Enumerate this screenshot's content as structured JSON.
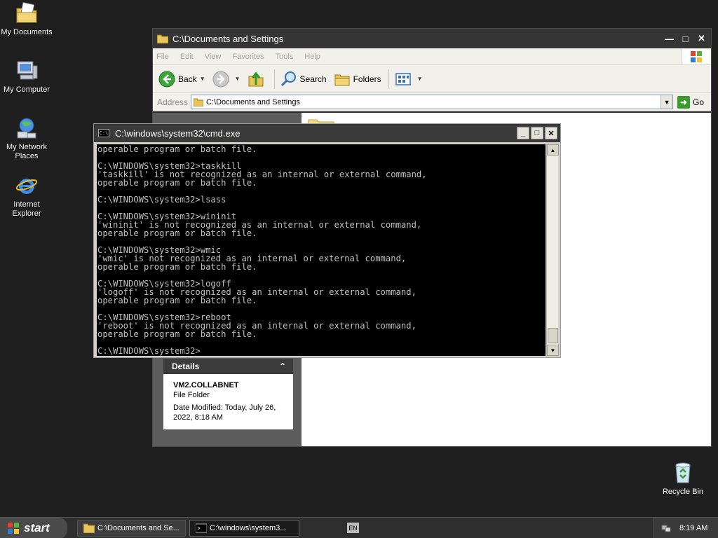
{
  "desktop": {
    "icons": [
      {
        "label": "My Documents"
      },
      {
        "label": "My Computer"
      },
      {
        "label": "My Network Places"
      },
      {
        "label": "Internet Explorer"
      }
    ],
    "recycle_bin": "Recycle Bin"
  },
  "explorer": {
    "title": "C:\\Documents and Settings",
    "menu": [
      "File",
      "Edit",
      "View",
      "Favorites",
      "Tools",
      "Help"
    ],
    "toolbar": {
      "back": "Back",
      "search": "Search",
      "folders": "Folders"
    },
    "address_label": "Address",
    "address_value": "C:\\Documents and Settings",
    "go": "Go",
    "details": {
      "header": "Details",
      "name": "VM2.COLLABNET",
      "type": "File Folder",
      "modified": "Date Modified: Today, July 26, 2022, 8:18 AM"
    }
  },
  "cmd": {
    "title": "C:\\windows\\system32\\cmd.exe",
    "lines": [
      "operable program or batch file.",
      "",
      "C:\\WINDOWS\\system32>taskkill",
      "'taskkill' is not recognized as an internal or external command,",
      "operable program or batch file.",
      "",
      "C:\\WINDOWS\\system32>lsass",
      "",
      "C:\\WINDOWS\\system32>wininit",
      "'wininit' is not recognized as an internal or external command,",
      "operable program or batch file.",
      "",
      "C:\\WINDOWS\\system32>wmic",
      "'wmic' is not recognized as an internal or external command,",
      "operable program or batch file.",
      "",
      "C:\\WINDOWS\\system32>logoff",
      "'logoff' is not recognized as an internal or external command,",
      "operable program or batch file.",
      "",
      "C:\\WINDOWS\\system32>reboot",
      "'reboot' is not recognized as an internal or external command,",
      "operable program or batch file.",
      "",
      "C:\\WINDOWS\\system32>"
    ]
  },
  "taskbar": {
    "start": "start",
    "tasks": [
      "C:\\Documents and Se...",
      "C:\\windows\\system3..."
    ],
    "language": "EN",
    "clock": "8:19 AM"
  }
}
